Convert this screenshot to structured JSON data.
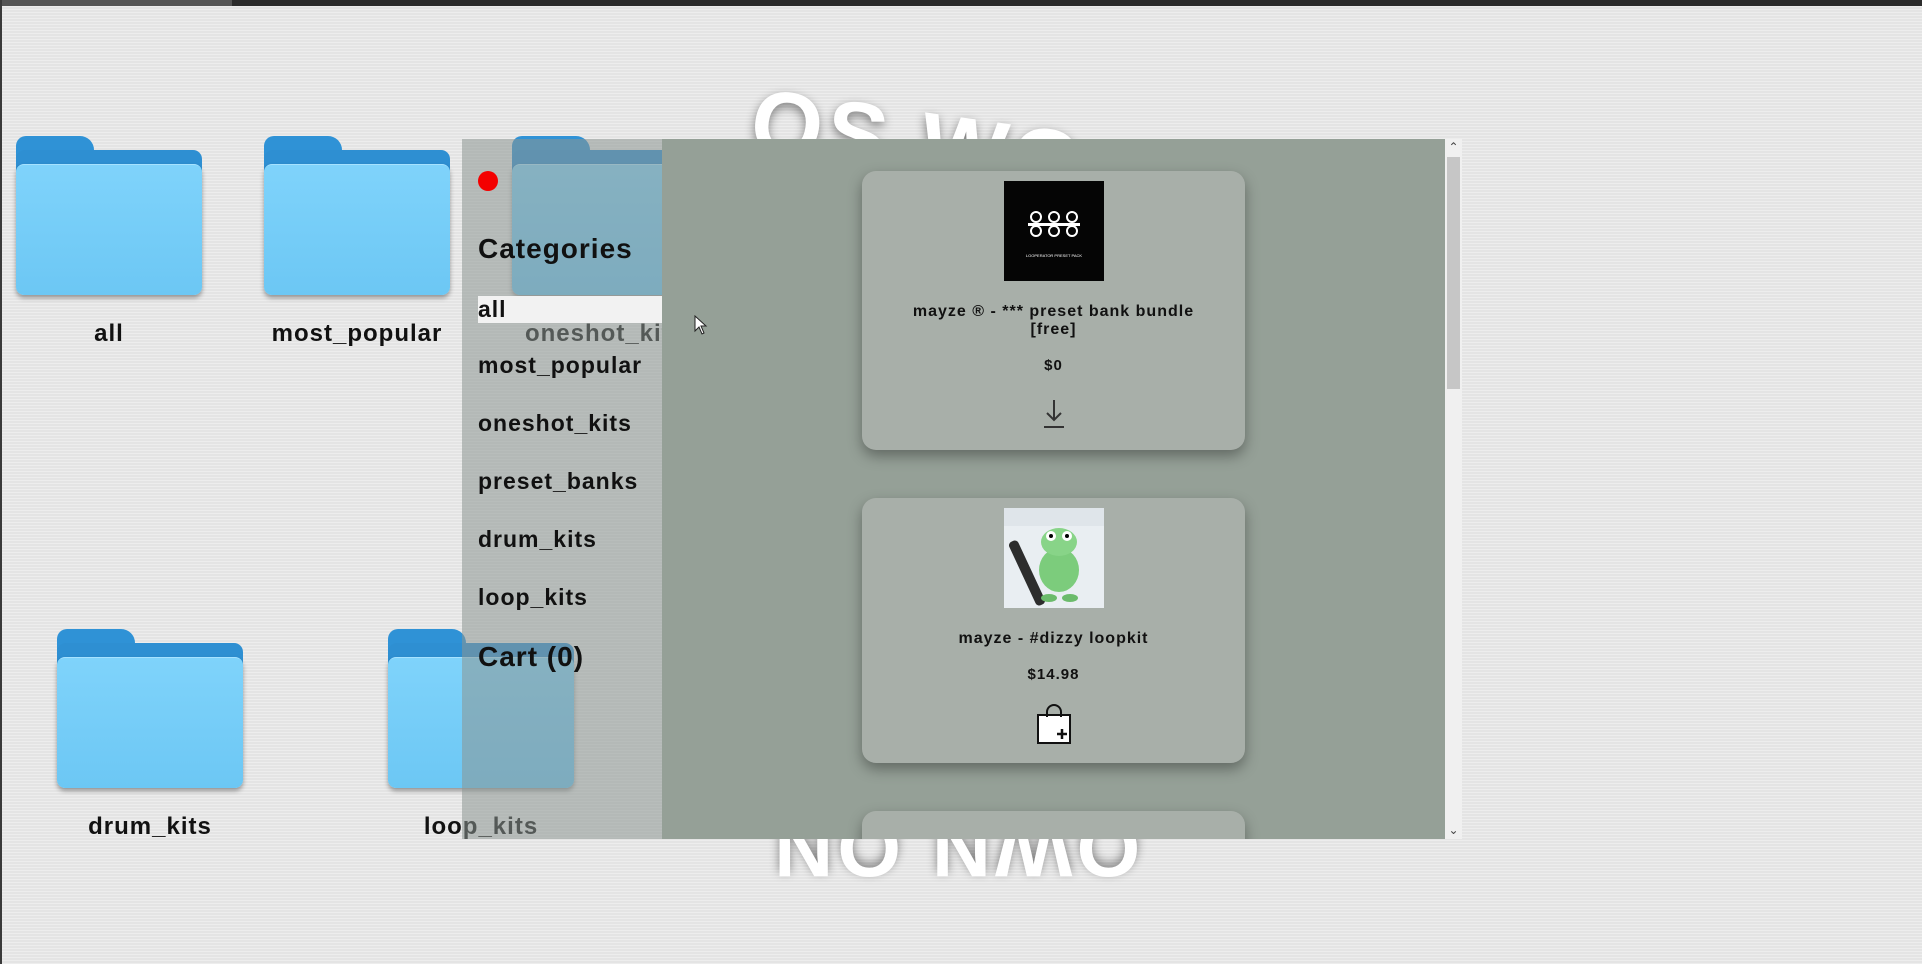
{
  "desktop": {
    "folders": [
      {
        "label": "all"
      },
      {
        "label": "most_popular"
      },
      {
        "label": "oneshot_kits"
      },
      {
        "label": "drum_kits"
      },
      {
        "label": "loop_kits"
      }
    ],
    "bg_text_top": "OS WO",
    "bg_text_bottom": "OWN ON",
    "folder_color": "#6cc7f4"
  },
  "panel": {
    "categories_title": "Categories",
    "categories": [
      {
        "label": "all",
        "selected": true
      },
      {
        "label": "most_popular"
      },
      {
        "label": "oneshot_kits"
      },
      {
        "label": "preset_banks"
      },
      {
        "label": "drum_kits"
      },
      {
        "label": "loop_kits"
      }
    ],
    "cart_label": "Cart (0)",
    "close_color": "#f40000"
  },
  "products": [
    {
      "name": "mayze ® - *** preset bank bundle [free]",
      "price": "$0",
      "action_icon": "download-icon",
      "thumb_text": "LOOPERATOR PRESET PACK"
    },
    {
      "name": "mayze - #dizzy loopkit",
      "price": "$14.98",
      "action_icon": "add-to-cart-icon"
    }
  ]
}
